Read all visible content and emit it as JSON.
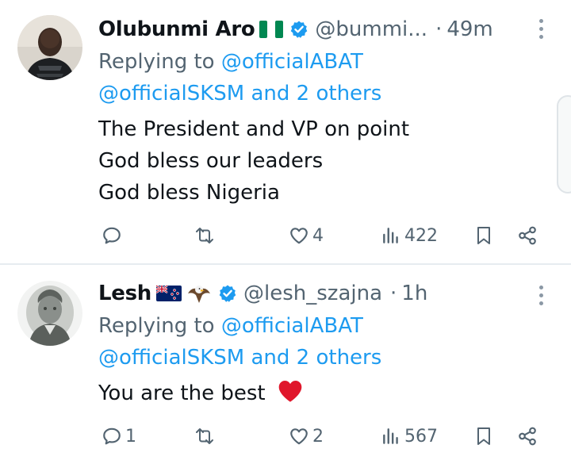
{
  "tweets": [
    {
      "name": "Olubunmi Aro",
      "flag": "nigeria-flag",
      "handle": "@bummi...",
      "separator": "·",
      "time": "49m",
      "reply_prefix": "Replying to",
      "mention_1": "@officialABAT",
      "mention_2": "@officialSKSM",
      "reply_others": "and 2 others",
      "lines": [
        "The President and VP on point",
        "God bless our leaders",
        "God bless Nigeria"
      ],
      "reply_count": "",
      "like_count": "4",
      "views_count": "422"
    },
    {
      "name": "Lesh",
      "flag": "new-zealand-flag",
      "extra_emoji": "eagle",
      "handle": "@lesh_szajna",
      "separator": "·",
      "time": "1h",
      "reply_prefix": "Replying to",
      "mention_1": "@officialABAT",
      "mention_2": "@officialSKSM",
      "reply_others": "and 2 others",
      "text": "You are the best",
      "text_emoji": "red-heart",
      "reply_count": "1",
      "like_count": "2",
      "views_count": "567"
    }
  ],
  "colors": {
    "text": "#0f1419",
    "secondary": "#536471",
    "link": "#1d9bf0",
    "verified": "#1d9bf0",
    "heart": "#e0162b"
  }
}
